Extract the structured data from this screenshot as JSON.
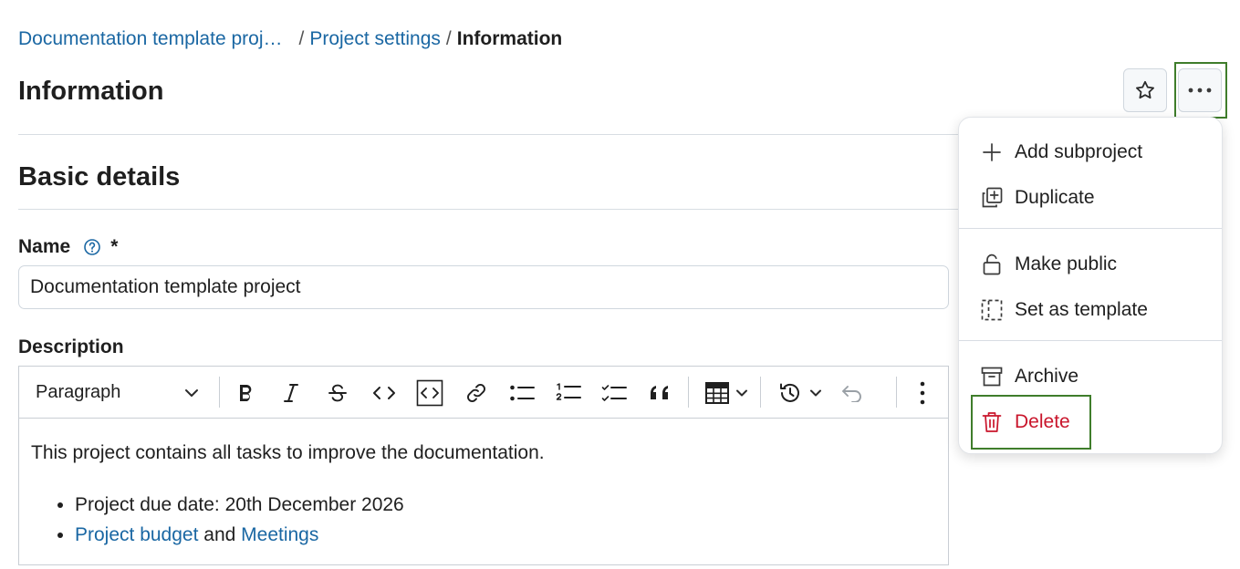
{
  "breadcrumb": {
    "project": "Documentation template proj…",
    "sep1": "/",
    "settings": "Project settings",
    "sep2": "/",
    "current": "Information"
  },
  "page": {
    "title": "Information",
    "section_title": "Basic details"
  },
  "form": {
    "name_label": "Name",
    "required_mark": "*",
    "name_value": "Documentation template project",
    "description_label": "Description"
  },
  "editor": {
    "block_style": "Paragraph",
    "body_text": "This project contains all tasks to improve the documentation.",
    "bullet1": "Project due date: 20th December 2026",
    "bullet2_link1": "Project budget",
    "bullet2_and": " and ",
    "bullet2_link2": "Meetings"
  },
  "menu": {
    "add_subproject": "Add subproject",
    "duplicate": "Duplicate",
    "make_public": "Make public",
    "set_as_template": "Set as template",
    "archive": "Archive",
    "delete": "Delete"
  },
  "colors": {
    "link": "#1a67a3",
    "danger": "#c9152b",
    "highlight_frame": "#3f7d2b"
  }
}
